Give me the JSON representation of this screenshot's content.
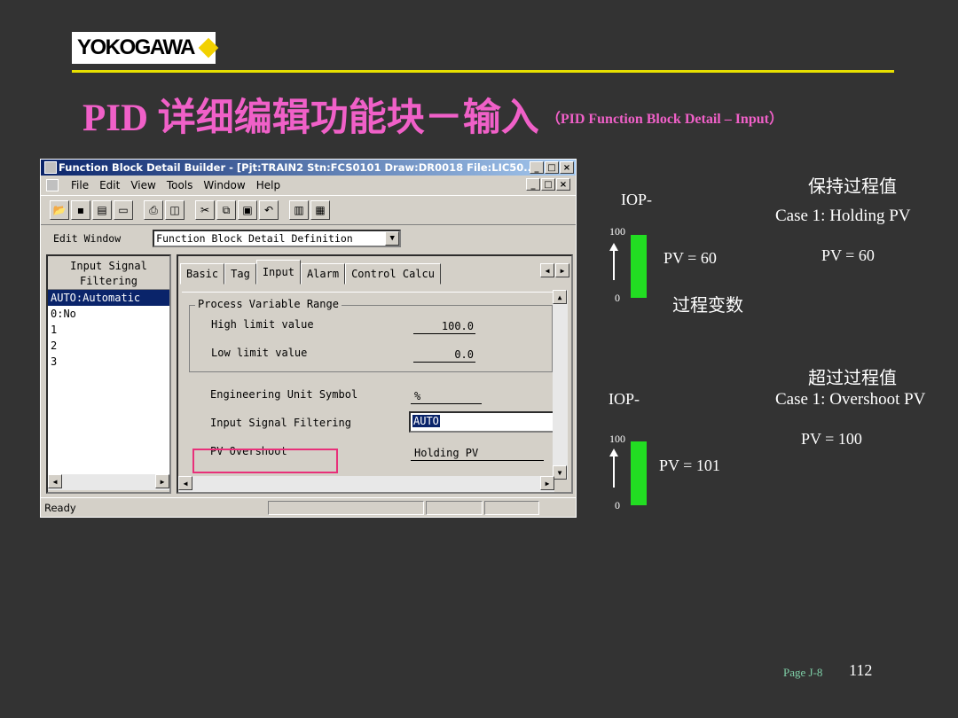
{
  "logo": {
    "text": "YOKOGAWA"
  },
  "slide": {
    "title": "PID 详细编辑功能块－输入",
    "subtitle": "（PID Function Block Detail – Input）",
    "page_label": "Page J-8",
    "page_number": "112"
  },
  "window": {
    "title": "Function Block Detail Builder - [Pjt:TRAIN2 Stn:FCS0101 Draw:DR0018 File:LIC50...",
    "title_buttons": [
      "_",
      "□",
      "×"
    ],
    "menu": [
      "File",
      "Edit",
      "View",
      "Tools",
      "Window",
      "Help"
    ],
    "menu_buttons": [
      "_",
      "□",
      "×"
    ],
    "edit_window_label": "Edit Window",
    "edit_window_value": "Function Block Detail Definition",
    "left_header": "Input Signal Filtering",
    "left_items": [
      "AUTO:Automatic",
      "0:No",
      "1",
      "2",
      "3"
    ],
    "tabs": [
      "Basic",
      "Tag",
      "Input",
      "Alarm",
      "Control Calcu"
    ],
    "group_title": "Process Variable Range",
    "high_limit_label": "High limit value",
    "high_limit_value": "100.0",
    "low_limit_label": "Low limit value",
    "low_limit_value": "0.0",
    "eu_label": "Engineering Unit Symbol",
    "eu_value": "%",
    "isf_label": "Input Signal Filtering",
    "isf_value": "AUTO",
    "pvo_label": "PV Overshoot",
    "pvo_value": "Holding PV",
    "status": "Ready"
  },
  "explain": {
    "case1": {
      "iop": "IOP-",
      "scale_top": "100",
      "scale_bottom": "0",
      "bar_pv": "PV = 60",
      "bar_level": 0.6,
      "pv_cn": "过程变数",
      "title_cn": "保持过程值",
      "title_en": "Case 1: Holding PV",
      "result": "PV = 60"
    },
    "case2": {
      "iop": "IOP-",
      "scale_top": "100",
      "scale_bottom": "0",
      "bar_pv": "PV = 101",
      "bar_level": 1.0,
      "title_cn": "超过过程值",
      "title_en": "Case 1: Overshoot PV",
      "result": "PV = 100"
    }
  },
  "colors": {
    "title": "#f060c8",
    "rule": "#e8e000",
    "bar": "#22dd22",
    "highlight": "#e8307a"
  }
}
